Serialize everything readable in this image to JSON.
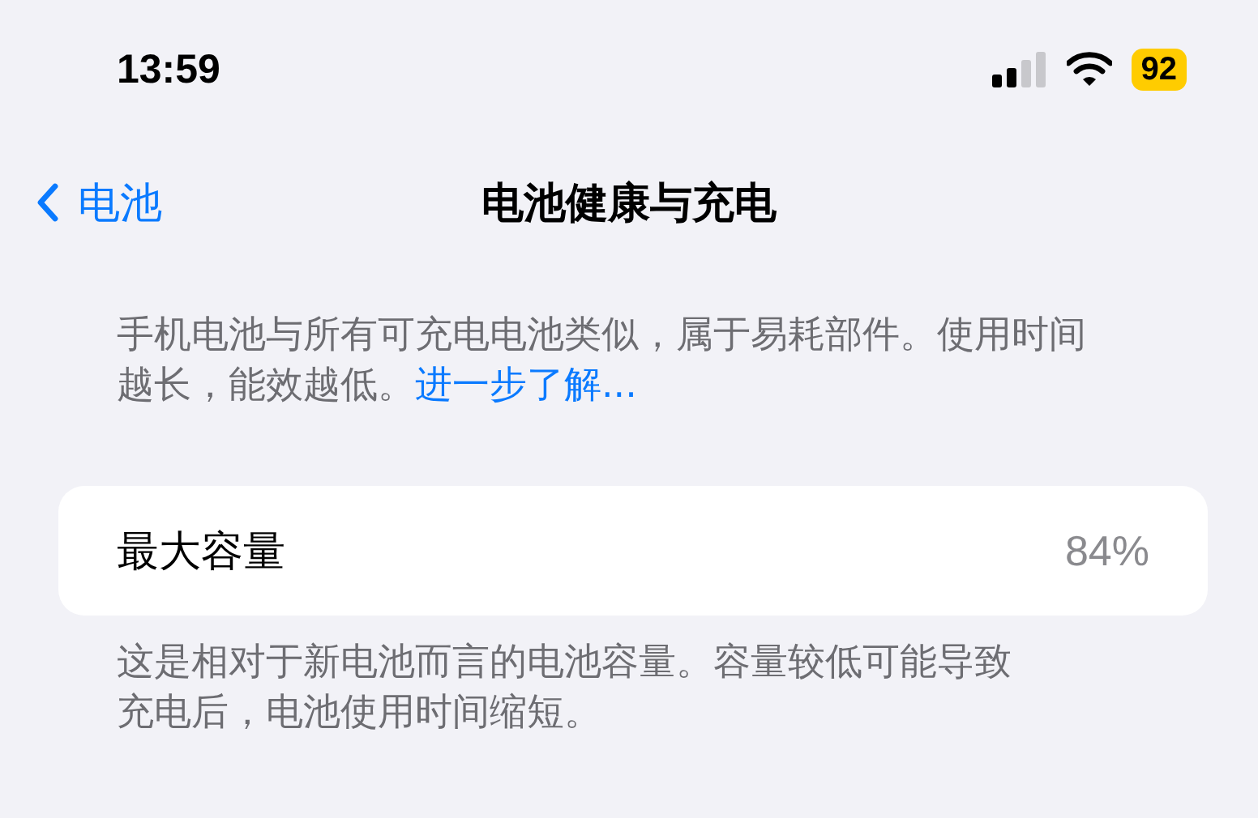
{
  "status_bar": {
    "time": "13:59",
    "battery": "92"
  },
  "nav": {
    "back": "电池",
    "title": "电池健康与充电"
  },
  "intro": {
    "text": "手机电池与所有可充电电池类似，属于易耗部件。使用时间越长，能效越低。",
    "link": "进一步了解..."
  },
  "capacity": {
    "label": "最大容量",
    "value": "84%"
  },
  "footer": "这是相对于新电池而言的电池容量。容量较低可能导致充电后，电池使用时间缩短。"
}
